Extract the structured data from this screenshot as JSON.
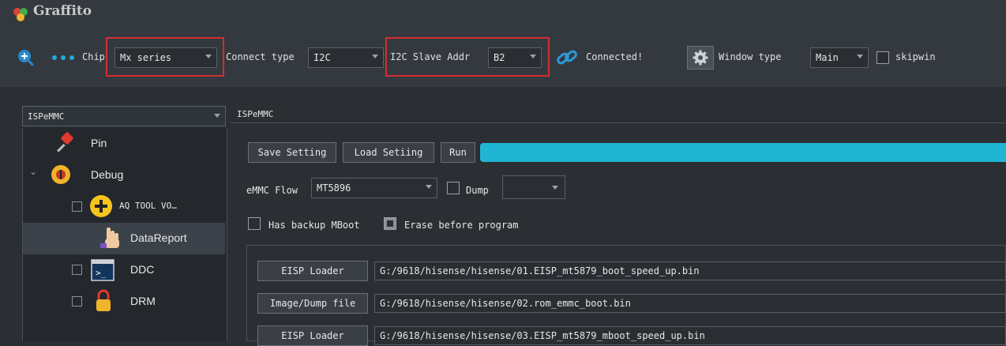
{
  "app": {
    "title": "Graffito"
  },
  "toolbar": {
    "chip_label": "Chip",
    "chip_value": "Mx series",
    "connect_type_label": "Connect type",
    "connect_type_value": "I2C",
    "slave_addr_label": "I2C Slave Addr",
    "slave_addr_value": "B2",
    "status": "Connected!",
    "window_type_label": "Window type",
    "window_type_value": "Main",
    "skipwin_label": "skipwin",
    "icons": [
      "zoom-icon",
      "more-icon",
      "link-icon",
      "settings-icon"
    ]
  },
  "sidebar": {
    "combo_value": "ISPeMMC",
    "items": [
      {
        "label": "Pin",
        "icon": "pushpin-icon"
      },
      {
        "label": "Debug",
        "icon": "bug-icon"
      },
      {
        "label": "AQ TOOL VO…",
        "icon": "plus-icon"
      },
      {
        "label": "DataReport",
        "icon": "hand-icon"
      },
      {
        "label": "DDC",
        "icon": "terminal-icon"
      },
      {
        "label": "DRM",
        "icon": "lock-icon"
      }
    ]
  },
  "main": {
    "panel_title": "ISPeMMC",
    "save_setting": "Save Setting",
    "load_setting": "Load Setiing",
    "run": "Run",
    "emmc_flow_label": "eMMC Flow",
    "emmc_flow_value": "MT5896",
    "dump_label": "Dump",
    "has_backup_label": "Has backup MBoot",
    "erase_label": "Erase before program",
    "file_rows": [
      {
        "button": "EISP Loader",
        "path": "G:/9618/hisense/hisense/01.EISP_mt5879_boot_speed_up.bin"
      },
      {
        "button": "Image/Dump file",
        "path": "G:/9618/hisense/hisense/02.rom_emmc_boot.bin"
      },
      {
        "button": "EISP Loader",
        "path": "G:/9618/hisense/hisense/03.EISP_mt5879_mboot_speed_up.bin"
      }
    ]
  },
  "colors": {
    "accent": "#1fb6d3",
    "highlight_box": "#d0302f",
    "background": "#2b2f34"
  }
}
